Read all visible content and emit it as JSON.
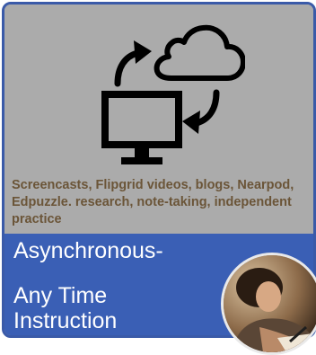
{
  "card": {
    "description": "Screencasts, Flipgrid videos, blogs, Nearpod, Edpuzzle. research, note-taking, independent practice",
    "title_line1": "Asynchronous-",
    "title_line2": "Any Time",
    "title_line3": "Instruction",
    "icon": "cloud-sync-monitor-icon",
    "photo": "student-writing-photo"
  },
  "colors": {
    "upper_bg": "#ababab",
    "lower_bg": "#3a5fb5",
    "border": "#3a5aa8",
    "description_text": "#6b5538",
    "title_text": "#ffffff"
  }
}
